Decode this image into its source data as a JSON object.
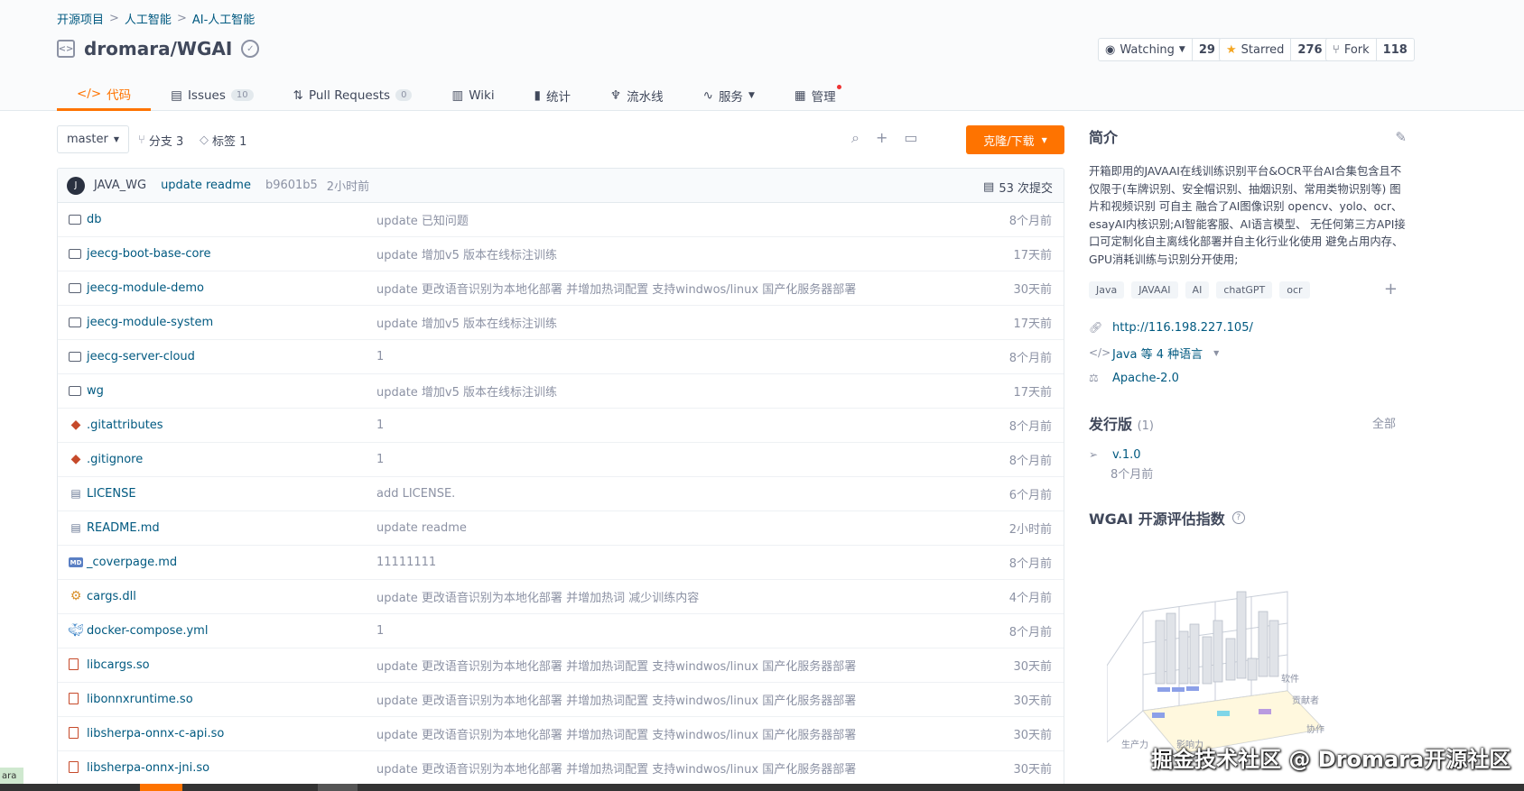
{
  "breadcrumb": [
    "开源项目",
    "人工智能",
    "AI-人工智能"
  ],
  "breadcrumb_sep": ">",
  "repo": {
    "name": "dromara/WGAI"
  },
  "actions": {
    "watch_label": "Watching",
    "watch_count": "29",
    "star_label": "Starred",
    "star_count": "276",
    "fork_label": "Fork",
    "fork_count": "118"
  },
  "tabs": [
    {
      "label": "代码",
      "icon": "code-icon",
      "active": true
    },
    {
      "label": "Issues",
      "count": "10",
      "icon": "issues-icon"
    },
    {
      "label": "Pull Requests",
      "count": "0",
      "icon": "pull-request-icon"
    },
    {
      "label": "Wiki",
      "icon": "book-icon"
    },
    {
      "label": "统计",
      "icon": "stats-icon"
    },
    {
      "label": "流水线",
      "icon": "pipeline-icon"
    },
    {
      "label": "服务",
      "icon": "pulse-icon"
    },
    {
      "label": "管理",
      "icon": "settings-doc-icon"
    }
  ],
  "toolbar": {
    "branch": "master",
    "branches_label": "分支 3",
    "tags_label": "标签 1",
    "clone_label": "克隆/下载"
  },
  "last_commit": {
    "avatar_letter": "J",
    "author": "JAVA_WG",
    "message": "update readme",
    "sha": "b9601b5",
    "time": "2小时前",
    "total_commits": "53 次提交"
  },
  "files": [
    {
      "name": "db",
      "type": "folder",
      "message": "update 已知问题",
      "time": "8个月前"
    },
    {
      "name": "jeecg-boot-base-core",
      "type": "folder",
      "message": "update 增加v5 版本在线标注训练",
      "time": "17天前"
    },
    {
      "name": "jeecg-module-demo",
      "type": "folder",
      "message": "update 更改语音识别为本地化部署 并增加热词配置 支持windwos/linux 国产化服务器部署",
      "time": "30天前"
    },
    {
      "name": "jeecg-module-system",
      "type": "folder",
      "message": "update 增加v5 版本在线标注训练",
      "time": "17天前"
    },
    {
      "name": "jeecg-server-cloud",
      "type": "folder",
      "message": "1",
      "time": "8个月前"
    },
    {
      "name": "wg",
      "type": "folder",
      "message": "update 增加v5 版本在线标注训练",
      "time": "17天前"
    },
    {
      "name": ".gitattributes",
      "type": "git",
      "message": "1",
      "time": "8个月前"
    },
    {
      "name": ".gitignore",
      "type": "git",
      "message": "1",
      "time": "8个月前"
    },
    {
      "name": "LICENSE",
      "type": "doc",
      "message": "add LICENSE.",
      "time": "6个月前"
    },
    {
      "name": "README.md",
      "type": "doc",
      "message": "update readme",
      "time": "2小时前"
    },
    {
      "name": "_coverpage.md",
      "type": "md",
      "message": "11111111",
      "time": "8个月前"
    },
    {
      "name": "cargs.dll",
      "type": "cog",
      "message": "update 更改语音识别为本地化部署 并增加热词 减少训练内容",
      "time": "4个月前"
    },
    {
      "name": "docker-compose.yml",
      "type": "docker",
      "message": "1",
      "time": "8个月前"
    },
    {
      "name": "libcargs.so",
      "type": "bin",
      "message": "update 更改语音识别为本地化部署 并增加热词配置 支持windwos/linux 国产化服务器部署",
      "time": "30天前"
    },
    {
      "name": "libonnxruntime.so",
      "type": "bin",
      "message": "update 更改语音识别为本地化部署 并增加热词配置 支持windwos/linux 国产化服务器部署",
      "time": "30天前"
    },
    {
      "name": "libsherpa-onnx-c-api.so",
      "type": "bin",
      "message": "update 更改语音识别为本地化部署 并增加热词配置 支持windwos/linux 国产化服务器部署",
      "time": "30天前"
    },
    {
      "name": "libsherpa-onnx-jni.so",
      "type": "bin",
      "message": "update 更改语音识别为本地化部署 并增加热词配置 支持windwos/linux 国产化服务器部署",
      "time": "30天前"
    }
  ],
  "sidebar": {
    "intro_title": "简介",
    "description": "开箱即用的JAVAAI在线训练识别平台&OCR平台AI合集包含且不仅限于(车牌识别、安全帽识别、抽烟识别、常用类物识别等) 图片和视频识别 可自主 融合了AI图像识别 opencv、yolo、ocr、esayAI内核识别;AI智能客服、AI语言模型、 无任何第三方API接口可定制化自主离线化部署并自主化行业化使用 避免占用内存、GPU消耗训练与识别分开使用;",
    "topics": [
      "Java",
      "JAVAAI",
      "AI",
      "chatGPT",
      "ocr"
    ],
    "website": "http://116.198.227.105/",
    "language": "Java 等 4 种语言",
    "license": "Apache-2.0",
    "release_title": "发行版",
    "release_count": "(1)",
    "release_all": "全部",
    "release_tag": "v.1.0",
    "release_time": "8个月前",
    "score_title": "WGAI 开源评估指数",
    "chart_axis": [
      "生产力",
      "影响力",
      "协作",
      "贡献者",
      "软件"
    ]
  },
  "watermark": "掘金技术社区 @ Dromara开源社区",
  "corner_tag": "ara"
}
